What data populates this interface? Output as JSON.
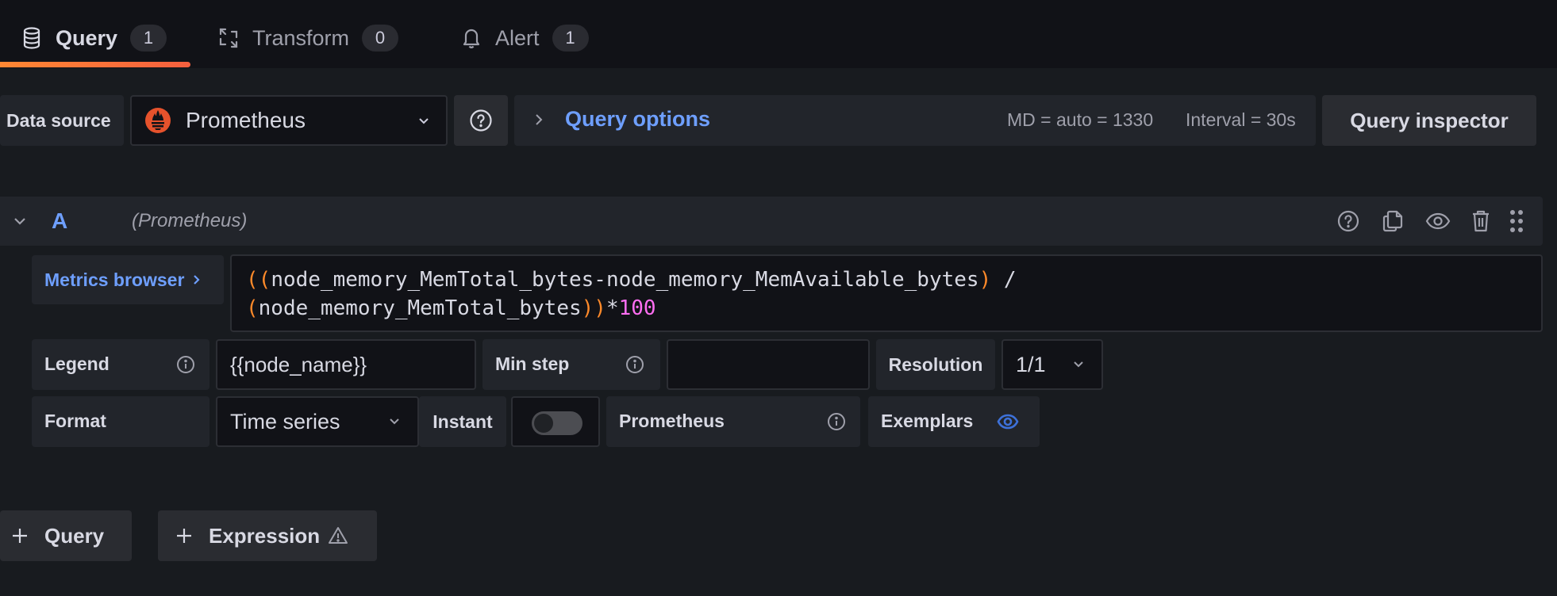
{
  "tabs": [
    {
      "label": "Query",
      "count": "1",
      "icon": "database-icon",
      "active": true
    },
    {
      "label": "Transform",
      "count": "0",
      "icon": "transform-icon",
      "active": false
    },
    {
      "label": "Alert",
      "count": "1",
      "icon": "bell-icon",
      "active": false
    }
  ],
  "toolbar": {
    "datasource_label": "Data source",
    "datasource_value": "Prometheus",
    "query_options_label": "Query options",
    "max_data_points": "MD = auto = 1330",
    "interval": "Interval = 30s",
    "query_inspector_label": "Query inspector"
  },
  "query": {
    "ref_id": "A",
    "datasource_name": "(Prometheus)",
    "metrics_browser_label": "Metrics browser",
    "expression": {
      "line1": [
        "((",
        "node_memory_MemTotal_bytes-node_memory_MemAvailable_bytes",
        ")",
        " /"
      ],
      "line2": [
        "(",
        "node_memory_MemTotal_bytes",
        "))",
        "*",
        "100"
      ]
    },
    "options": {
      "legend_label": "Legend",
      "legend_value": "{{node_name}}",
      "min_step_label": "Min step",
      "min_step_value": "",
      "resolution_label": "Resolution",
      "resolution_value": "1/1",
      "format_label": "Format",
      "format_value": "Time series",
      "instant_label": "Instant",
      "instant_enabled": false,
      "prometheus_label": "Prometheus",
      "exemplars_label": "Exemplars"
    }
  },
  "actions": {
    "add_query_label": "Query",
    "add_expression_label": "Expression"
  },
  "colors": {
    "accent_blue": "#6e9fff",
    "tab_underline_start": "#ff8833",
    "tab_underline_end": "#f55f3e",
    "prometheus_brand": "#e6522c"
  }
}
